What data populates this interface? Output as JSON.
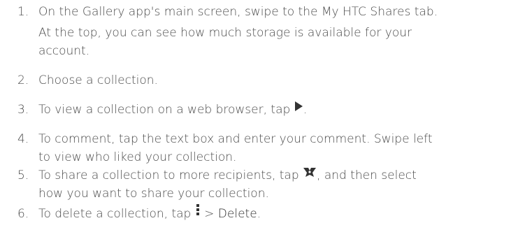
{
  "steps": [
    {
      "num": "1.",
      "line1": "On the Gallery app's main screen, swipe to the My HTC Shares tab.",
      "note_line1": "At the top, you can see how much storage is available for your",
      "note_line2": "account."
    },
    {
      "num": "2.",
      "text": "Choose a collection."
    },
    {
      "num": "3.",
      "before": "To view a collection on a web browser, tap ",
      "icon": "play-icon",
      "after": "."
    },
    {
      "num": "4.",
      "line1": "To comment, tap the text box and enter your comment. Swipe left",
      "line2": "to view who liked your collection."
    },
    {
      "num": "5.",
      "before": "To share a collection to more recipients, tap ",
      "icon": "share-icon",
      "after": ", and then select",
      "line2": "how you want to share your collection."
    },
    {
      "num": "6.",
      "before": "To delete a collection, tap ",
      "icon": "more-vertical-icon",
      "middle": " > ",
      "bold": "Delete",
      "after": "."
    }
  ],
  "colors": {
    "text": "#4a4a4a",
    "icon": "#333333"
  }
}
